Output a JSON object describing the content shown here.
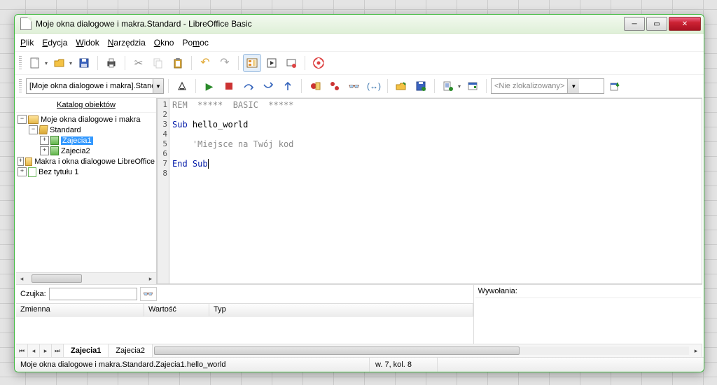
{
  "window": {
    "title": "Moje okna dialogowe i makra.Standard - LibreOffice Basic"
  },
  "menu": {
    "plik": "Plik",
    "edycja": "Edycja",
    "widok": "Widok",
    "narzedzia": "Narzędzia",
    "okno": "Okno",
    "pomoc": "Pomoc"
  },
  "toolbar2": {
    "lib_selector": "[Moje okna dialogowe i makra].Standard",
    "locator": "<Nie zlokalizowany>"
  },
  "sidebar": {
    "title": "Katalog obiektów",
    "nodes": {
      "root1": "Moje okna dialogowe i makra",
      "lib1": "Standard",
      "mod1": "Zajecia1",
      "mod2": "Zajecia2",
      "root2": "Makra i okna dialogowe LibreOffice",
      "root3": "Bez tytułu 1"
    }
  },
  "code": {
    "l1": "REM  *****  BASIC  *****",
    "l3a": "Sub ",
    "l3b": "hello_world",
    "l5": "    'Miejsce na Twój kod",
    "l7a": "End ",
    "l7b": "Sub"
  },
  "watch": {
    "label": "Czujka:",
    "col1": "Zmienna",
    "col2": "Wartość",
    "col3": "Typ"
  },
  "calls": {
    "label": "Wywołania:"
  },
  "tabs": {
    "t1": "Zajecia1",
    "t2": "Zajecia2"
  },
  "status": {
    "path": "Moje okna dialogowe i makra.Standard.Zajecia1.hello_world",
    "pos": "w. 7, kol. 8"
  }
}
